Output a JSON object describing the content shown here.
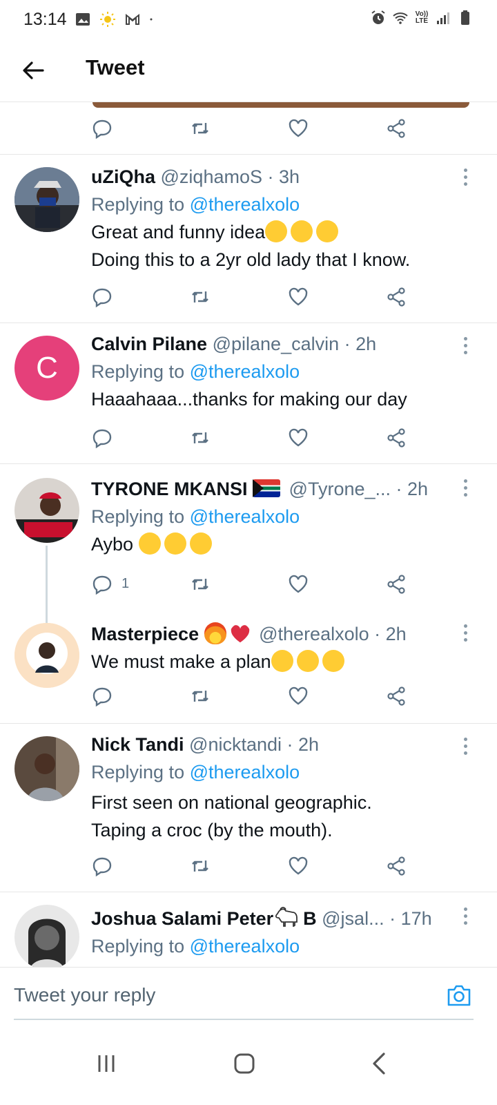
{
  "status_bar": {
    "time": "13:14",
    "icons_left": [
      "image-icon",
      "weather-sun-icon",
      "gmail-icon",
      "dot-icon"
    ],
    "icons_right": [
      "alarm-icon",
      "wifi-icon",
      "volte-lte-icon",
      "signal-icon",
      "battery-icon"
    ],
    "lte_label_top": "Vo))",
    "lte_label_bottom": "LTE"
  },
  "header": {
    "title": "Tweet"
  },
  "replies": [
    {
      "name": "uZiQha",
      "handle": "@ziqhamoS",
      "time": "· 3h",
      "replying_prefix": "Replying to",
      "replying_to": "@therealxolo",
      "text_lines": [
        "Great and funny idea",
        "Doing this to a 2yr old lady that I know."
      ],
      "emojis": [
        "rolling-laughing-emoji",
        "rolling-laughing-emoji",
        "joy-emoji"
      ]
    },
    {
      "name": "Calvin Pilane",
      "handle": "@pilane_calvin",
      "time": "· 2h",
      "replying_prefix": "Replying to",
      "replying_to": "@therealxolo",
      "text": "Haaahaaa...thanks for making our day",
      "avatar_letter": "C",
      "avatar_color": "#e5407a"
    },
    {
      "name": "TYRONE MKANSI",
      "handle": "@Tyrone_...",
      "time": "· 2h",
      "replying_prefix": "Replying to",
      "replying_to": "@therealxolo",
      "text": "Aybo",
      "reply_count": "1",
      "emojis": [
        "south-africa-flag-emoji",
        "loudly-crying-emoji",
        "loudly-crying-emoji",
        "loudly-crying-emoji"
      ]
    },
    {
      "name": "Masterpiece",
      "handle": "@therealxolo",
      "time": "· 2h",
      "text": "We must make a plan",
      "emojis": [
        "fire-emoji",
        "red-heart-emoji",
        "joy-emoji",
        "joy-emoji",
        "joy-emoji"
      ]
    },
    {
      "name": "Nick Tandi",
      "handle": "@nicktandi",
      "time": "· 2h",
      "replying_prefix": "Replying to",
      "replying_to": "@therealxolo",
      "text_lines": [
        "First seen on national geographic.",
        "Taping a croc (by the mouth)."
      ]
    },
    {
      "name": "Joshua Salami Peter",
      "name_suffix": "B",
      "handle": "@jsal...",
      "time": "· 17h",
      "replying_prefix": "Replying to",
      "replying_to": "@therealxolo",
      "emojis": [
        "goat-emoji"
      ]
    }
  ],
  "reply_bar": {
    "placeholder": "Tweet your reply"
  },
  "nav_bar": {
    "buttons": [
      "recent-apps-icon",
      "home-icon",
      "back-icon"
    ]
  },
  "colors": {
    "accent": "#1d9bf0",
    "muted": "#5b7083",
    "divider": "#e6e6e6"
  }
}
